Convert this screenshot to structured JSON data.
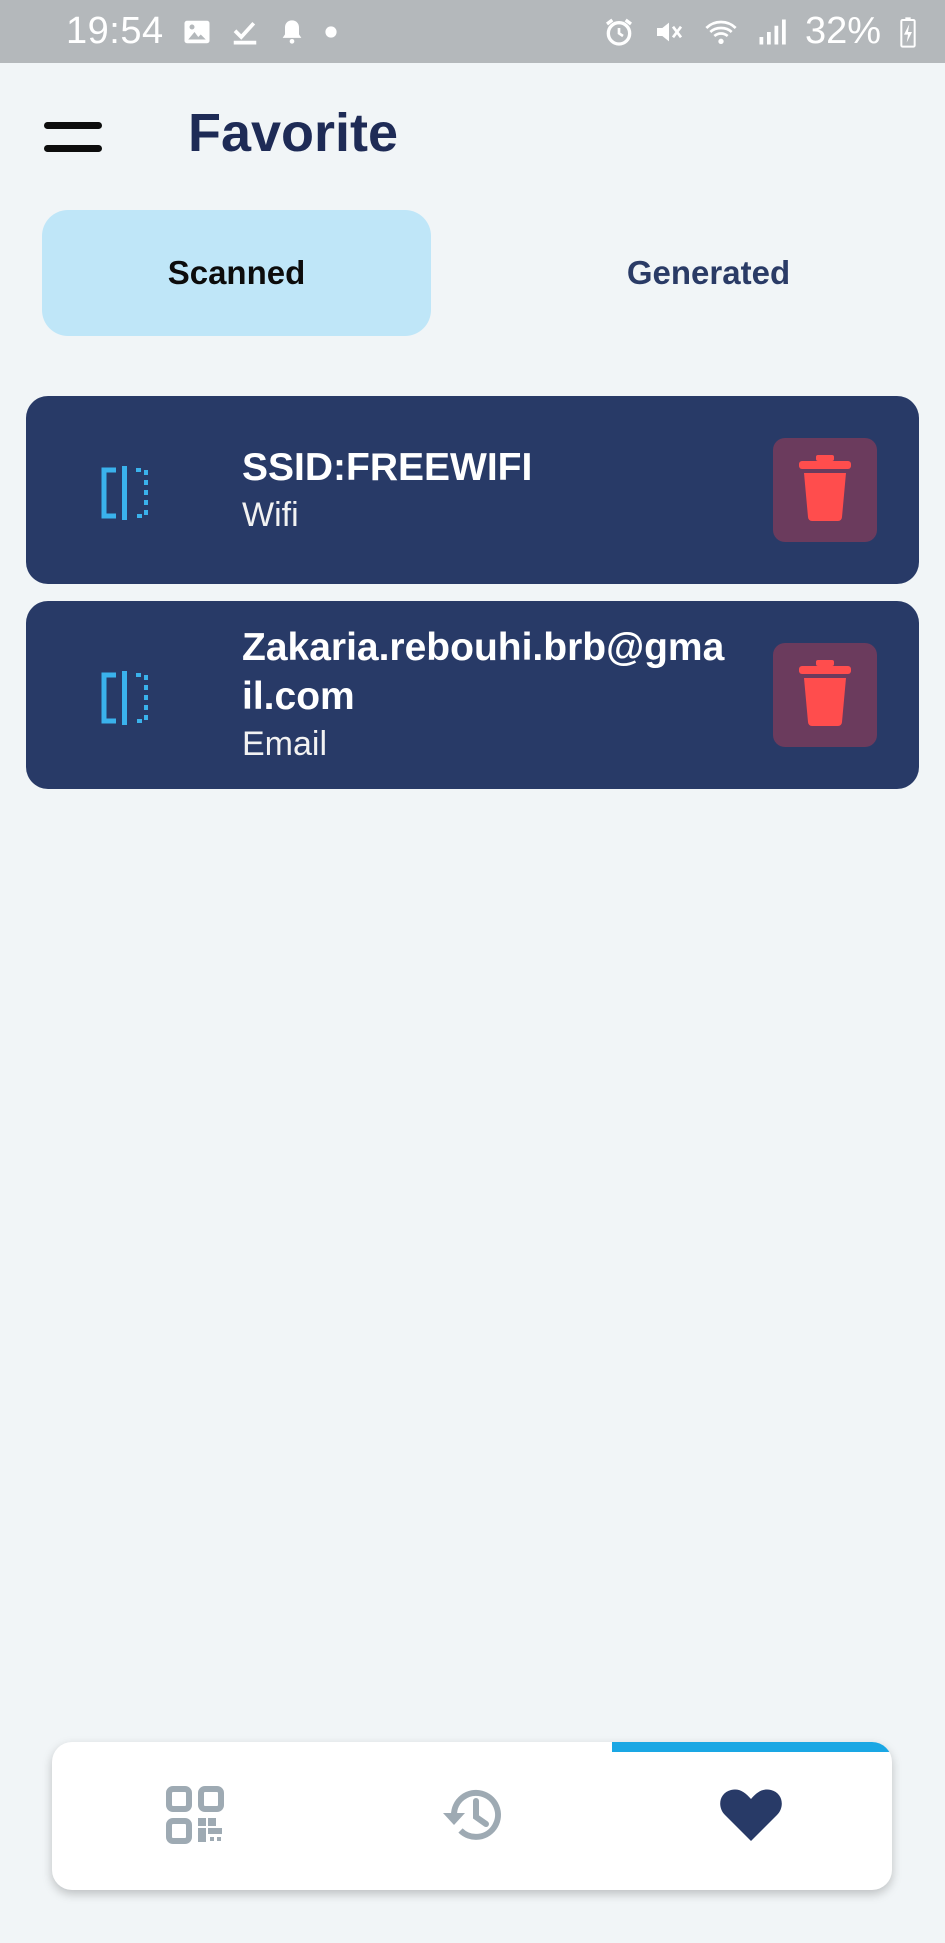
{
  "status_bar": {
    "time": "19:54",
    "battery": "32%",
    "icons": [
      "image-icon",
      "check-download-icon",
      "bell-icon",
      "dot-icon",
      "alarm-icon",
      "mute-icon",
      "wifi-icon",
      "signal-icon",
      "battery-charging-icon"
    ]
  },
  "header": {
    "menu_icon": "hamburger-menu-icon",
    "title": "Favorite"
  },
  "tabs": [
    {
      "label": "Scanned",
      "active": true
    },
    {
      "label": "Generated",
      "active": false
    }
  ],
  "items": [
    {
      "title": "SSID:FREEWIFI",
      "type": "Wifi",
      "icon": "scan-frame-icon",
      "action_icon": "trash-icon"
    },
    {
      "title": "Zakaria.rebouhi.brb@gmail.com",
      "type": "Email",
      "icon": "scan-frame-icon",
      "action_icon": "trash-icon"
    }
  ],
  "bottom_nav": [
    {
      "name": "scan",
      "icon": "qr-code-icon",
      "active": false
    },
    {
      "name": "history",
      "icon": "history-icon",
      "active": false
    },
    {
      "name": "favorite",
      "icon": "heart-icon",
      "active": true
    }
  ],
  "colors": {
    "background": "#f1f5f7",
    "status_bar": "#b4b8bb",
    "title": "#1e2b56",
    "active_tab": "#bfe6f8",
    "card": "#283a67",
    "delete_bg": "#6b3b5d",
    "delete_icon": "#ff4d4d",
    "scan_icon": "#3ab2ec",
    "nav_active": "#1aa7e4",
    "nav_inactive": "#9eaab3"
  }
}
